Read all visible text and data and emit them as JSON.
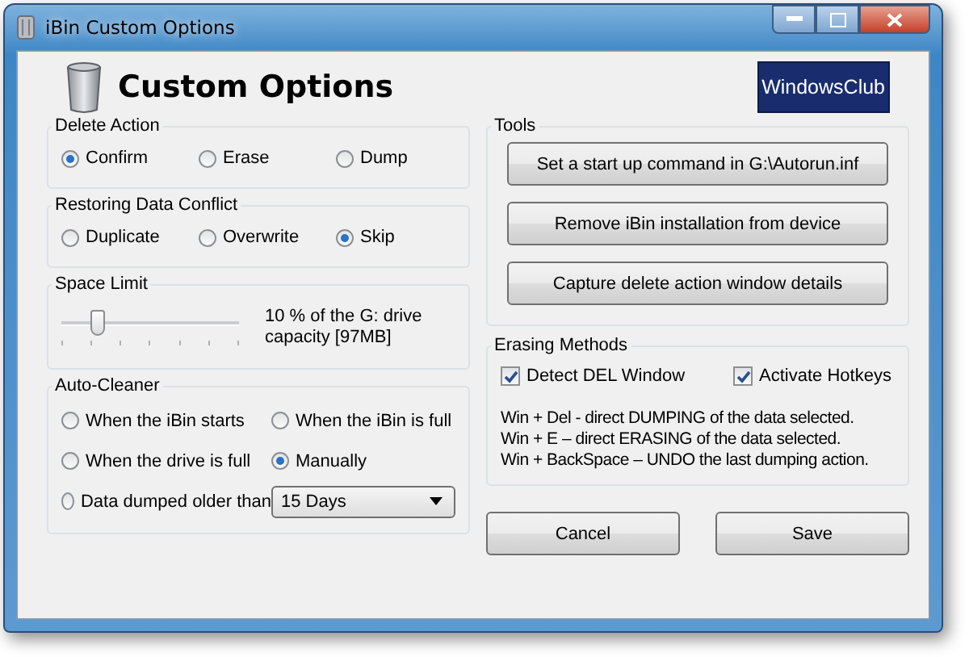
{
  "window": {
    "title": "iBin Custom Options"
  },
  "header": {
    "title": "Custom Options",
    "logo": "WindowsClub"
  },
  "delete_action": {
    "label": "Delete Action",
    "options": [
      {
        "label": "Confirm",
        "selected": true
      },
      {
        "label": "Erase",
        "selected": false
      },
      {
        "label": "Dump",
        "selected": false
      }
    ]
  },
  "restoring_data_conflict": {
    "label": "Restoring Data Conflict",
    "options": [
      {
        "label": "Duplicate",
        "selected": false
      },
      {
        "label": "Overwrite",
        "selected": false
      },
      {
        "label": "Skip",
        "selected": true
      }
    ]
  },
  "space_limit": {
    "label": "Space Limit",
    "level": 0.2,
    "reading": "10 % of the G: drive capacity [97MB]"
  },
  "auto_cleaner": {
    "label": "Auto-Cleaner",
    "options": [
      {
        "label": "When the iBin starts",
        "selected": false
      },
      {
        "label": "When the iBin is full",
        "selected": false
      },
      {
        "label": "When the drive is full",
        "selected": false
      },
      {
        "label": "Manually",
        "selected": true
      },
      {
        "label": "Data dumped older than",
        "selected": false
      }
    ],
    "dropdown": {
      "value": "15 Days"
    }
  },
  "tools": {
    "label": "Tools",
    "buttons": [
      "Set a start up command in G:\\Autorun.inf",
      "Remove iBin installation from device",
      "Capture delete action window details"
    ]
  },
  "erasing_methods": {
    "label": "Erasing Methods",
    "checkboxes": [
      {
        "label": "Detect DEL Window",
        "checked": true
      },
      {
        "label": "Activate Hotkeys",
        "checked": true
      }
    ],
    "lines": [
      "Win + Del - direct DUMPING of the data selected.",
      "Win + E – direct ERASING of the data selected.",
      "Win + BackSpace – UNDO the last dumping action."
    ]
  },
  "footer_buttons": [
    "Cancel",
    "Save"
  ]
}
